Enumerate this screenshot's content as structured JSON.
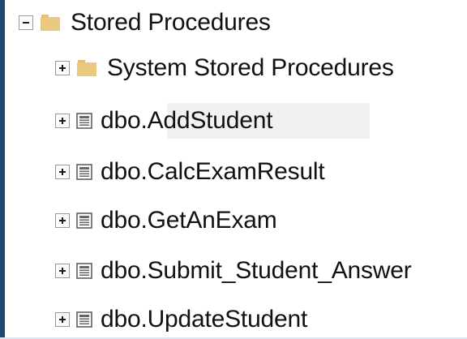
{
  "tree": {
    "root": {
      "label": "Stored Procedures",
      "expanded": true,
      "icon": "folder-icon"
    },
    "children": [
      {
        "label": "System Stored Procedures",
        "icon": "folder-icon",
        "expanded": false
      },
      {
        "label": "dbo.AddStudent",
        "icon": "stored-procedure-icon",
        "expanded": false,
        "selected": true
      },
      {
        "label": "dbo.CalcExamResult",
        "icon": "stored-procedure-icon",
        "expanded": false
      },
      {
        "label": "dbo.GetAnExam",
        "icon": "stored-procedure-icon",
        "expanded": false
      },
      {
        "label": "dbo.Submit_Student_Answer",
        "icon": "stored-procedure-icon",
        "expanded": false
      },
      {
        "label": "dbo.UpdateStudent",
        "icon": "stored-procedure-icon",
        "expanded": false
      }
    ]
  },
  "theme": {
    "accent_strip": "#1f4a72",
    "folder": "#eac880",
    "selection": "#f1f1f1",
    "text": "#111111"
  }
}
